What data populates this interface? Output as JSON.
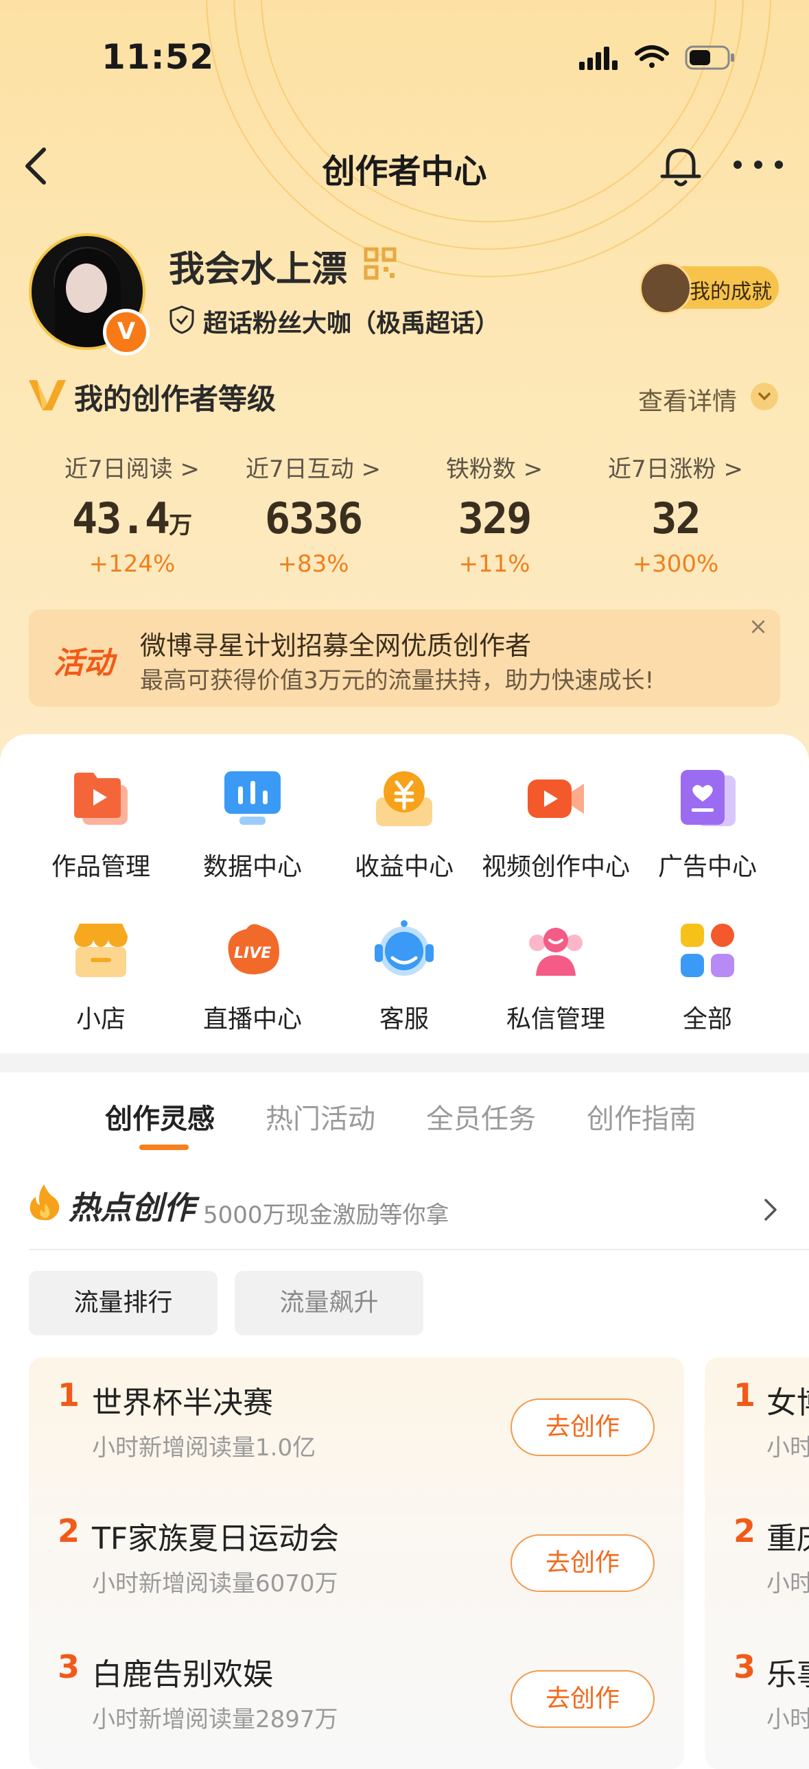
{
  "status_bar": {
    "time": "11:52"
  },
  "nav": {
    "title": "创作者中心"
  },
  "profile": {
    "name": "我会水上漂",
    "badge_letter": "V",
    "fan_title": "超话粉丝大咖（极禹超话）",
    "achievement_label": "我的成就"
  },
  "level": {
    "title": "我的创作者等级",
    "detail_link": "查看详情"
  },
  "stats": [
    {
      "label": "近7日阅读 >",
      "value": "43.4",
      "unit": "万",
      "change": "+124%"
    },
    {
      "label": "近7日互动 >",
      "value": "6336",
      "unit": "",
      "change": "+83%"
    },
    {
      "label": "铁粉数 >",
      "value": "329",
      "unit": "",
      "change": "+11%"
    },
    {
      "label": "近7日涨粉 >",
      "value": "32",
      "unit": "",
      "change": "+300%"
    }
  ],
  "banner": {
    "tag": "活动",
    "line1": "微博寻星计划招募全网优质创作者",
    "line2": "最高可获得价值3万元的流量扶持，助力快速成长!",
    "close": "×"
  },
  "tools": [
    {
      "label": "作品管理",
      "icon": "works-icon",
      "color": "#f46a3a"
    },
    {
      "label": "数据中心",
      "icon": "data-center-icon",
      "color": "#3a9af6"
    },
    {
      "label": "收益中心",
      "icon": "earnings-icon",
      "color": "#f6a21a"
    },
    {
      "label": "视频创作中心",
      "icon": "video-icon",
      "color": "#f4592c"
    },
    {
      "label": "广告中心",
      "icon": "ad-icon",
      "color": "#9b6cf2"
    },
    {
      "label": "小店",
      "icon": "shop-icon",
      "color": "#f6a81e"
    },
    {
      "label": "直播中心",
      "icon": "live-icon",
      "color": "#f26a2a"
    },
    {
      "label": "客服",
      "icon": "customer-service-icon",
      "color": "#3a9af6"
    },
    {
      "label": "私信管理",
      "icon": "messages-icon",
      "color": "#f45b86"
    },
    {
      "label": "全部",
      "icon": "all-icon",
      "color": "#f6c21a"
    }
  ],
  "tabs": [
    "创作灵感",
    "热门活动",
    "全员任务",
    "创作指南"
  ],
  "hot": {
    "title": "热点创作",
    "subtitle": "5000万现金激励等你拿"
  },
  "chips": [
    "流量排行",
    "流量飙升"
  ],
  "hot_list": [
    {
      "rank": "1",
      "title": "世界杯半决赛",
      "sub": "小时新增阅读量1.0亿",
      "action": "去创作"
    },
    {
      "rank": "2",
      "title": "TF家族夏日运动会",
      "sub": "小时新增阅读量6070万",
      "action": "去创作"
    },
    {
      "rank": "3",
      "title": "白鹿告别欢娱",
      "sub": "小时新增阅读量2897万",
      "action": "去创作"
    }
  ],
  "hot_list_2": [
    {
      "rank": "1",
      "title": "女博",
      "sub": "小时"
    },
    {
      "rank": "2",
      "title": "重庆",
      "sub": "小时"
    },
    {
      "rank": "3",
      "title": "乐事",
      "sub": "小时"
    }
  ]
}
